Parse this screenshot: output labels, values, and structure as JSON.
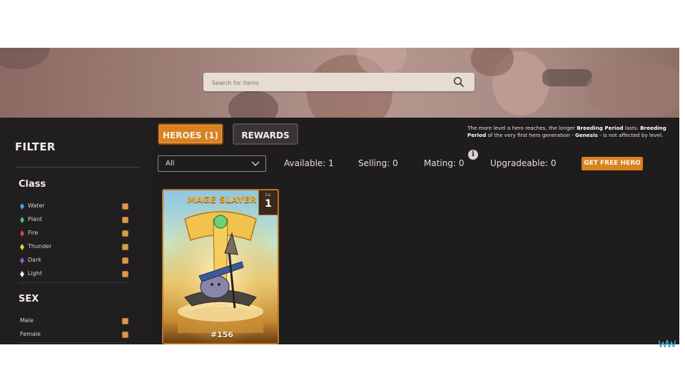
{
  "search": {
    "placeholder": "Search for items"
  },
  "sidebar": {
    "title": "FILTER",
    "class_section": {
      "title": "Class",
      "items": [
        {
          "label": "Water",
          "color": "#4aa3e8"
        },
        {
          "label": "Plant",
          "color": "#4fc46a"
        },
        {
          "label": "Fire",
          "color": "#e2453c"
        },
        {
          "label": "Thunder",
          "color": "#e8d23a"
        },
        {
          "label": "Dark",
          "color": "#9b5cd6"
        },
        {
          "label": "Light",
          "color": "#f2f2f2"
        }
      ]
    },
    "sex_section": {
      "title": "SEX",
      "items": [
        {
          "label": "Male"
        },
        {
          "label": "Female"
        }
      ]
    }
  },
  "tabs": {
    "heroes": "HEROES (1)",
    "rewards": "REWARDS"
  },
  "notice": {
    "part1": "The more level a hero reaches, the longer ",
    "bold1": "Breeding Period",
    "part2": " lasts. ",
    "bold2": "Breeding Period",
    "part3": " of the very first hero generation - ",
    "bold3": "Genesis",
    "part4": " - is not affected by level."
  },
  "filter_select": {
    "value": "All"
  },
  "stats": {
    "available": "Available: 1",
    "selling": "Selling: 0",
    "mating": "Mating: 0",
    "upgradeable": "Upgradeable: 0"
  },
  "info_icon": "i",
  "free_hero_button": "GET FREE HERO",
  "hero_card": {
    "name": "MAGE SLAYER",
    "level_label": "Lv.",
    "level": "1",
    "id": "#156"
  },
  "colors": {
    "accent": "#d98222",
    "background": "#1e1c1d",
    "card_border": "#b87521"
  }
}
